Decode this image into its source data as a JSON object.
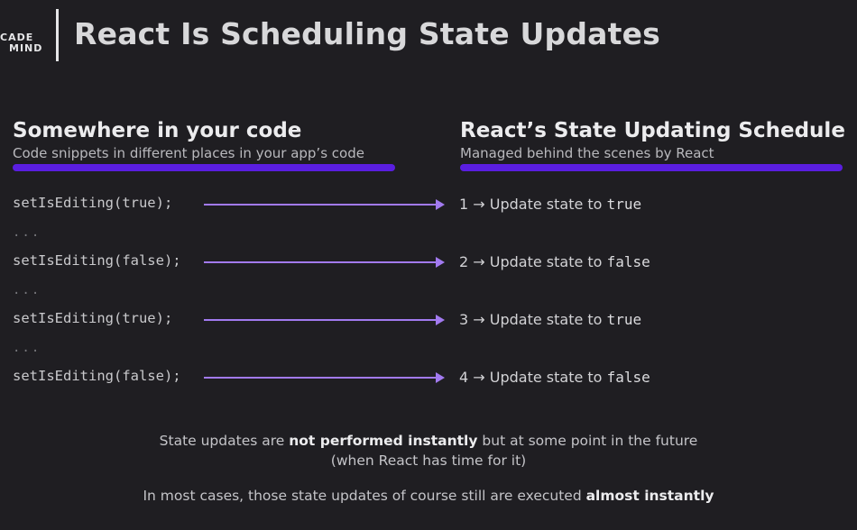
{
  "header": {
    "logo_line1": "CADE",
    "logo_line2": "MIND",
    "title": "React Is Scheduling State Updates"
  },
  "left_column": {
    "heading": "Somewhere in your code",
    "subheading": "Code snippets in different places in your app’s code",
    "calls": [
      "setIsEditing(true);",
      "setIsEditing(false);",
      "setIsEditing(true);",
      "setIsEditing(false);"
    ],
    "separator": "..."
  },
  "right_column": {
    "heading": "React’s State Updating Schedule",
    "subheading": "Managed behind the scenes by React",
    "steps": [
      {
        "prefix": "1 → Update state to ",
        "value": "true"
      },
      {
        "prefix": "2 → Update state to ",
        "value": "false"
      },
      {
        "prefix": "3 → Update state to ",
        "value": "true"
      },
      {
        "prefix": "4 → Update state to ",
        "value": "false"
      }
    ]
  },
  "notes": {
    "line1_pre": "State updates are ",
    "line1_bold": "not performed instantly",
    "line1_post": " but at some point in the future",
    "line2": "(when React has time for it)",
    "line3_pre": "In most cases, those state updates of course still are executed ",
    "line3_bold": "almost instantly"
  },
  "colors": {
    "background": "#1f1e22",
    "underline": "#5a1ee0",
    "arrow": "#a27af0"
  }
}
